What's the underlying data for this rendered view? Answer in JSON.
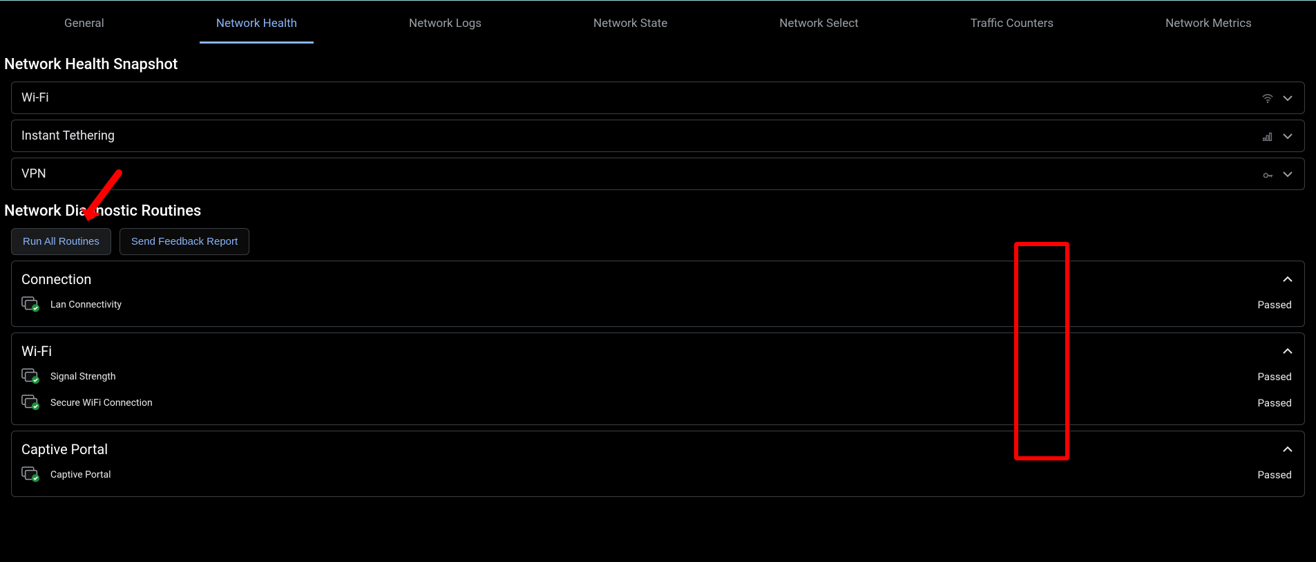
{
  "tabs": {
    "items": [
      {
        "label": "General"
      },
      {
        "label": "Network Health"
      },
      {
        "label": "Network Logs"
      },
      {
        "label": "Network State"
      },
      {
        "label": "Network Select"
      },
      {
        "label": "Traffic Counters"
      },
      {
        "label": "Network Metrics"
      }
    ],
    "active_index": 1
  },
  "snapshot": {
    "heading": "Network Health Snapshot",
    "panels": [
      {
        "label": "Wi-Fi",
        "icon": "wifi"
      },
      {
        "label": "Instant Tethering",
        "icon": "signal"
      },
      {
        "label": "VPN",
        "icon": "key"
      }
    ]
  },
  "routines": {
    "heading": "Network Diagnostic Routines",
    "buttons": {
      "run_all": "Run All Routines",
      "feedback": "Send Feedback Report"
    },
    "groups": [
      {
        "title": "Connection",
        "items": [
          {
            "name": "Lan Connectivity",
            "status": "Passed"
          }
        ]
      },
      {
        "title": "Wi-Fi",
        "items": [
          {
            "name": "Signal Strength",
            "status": "Passed"
          },
          {
            "name": "Secure WiFi Connection",
            "status": "Passed"
          }
        ]
      },
      {
        "title": "Captive Portal",
        "items": [
          {
            "name": "Captive Portal",
            "status": "Passed"
          }
        ]
      }
    ]
  },
  "annotations": {
    "red_arrow_target": "run-all-routines-button",
    "red_box_target": "status-column"
  }
}
